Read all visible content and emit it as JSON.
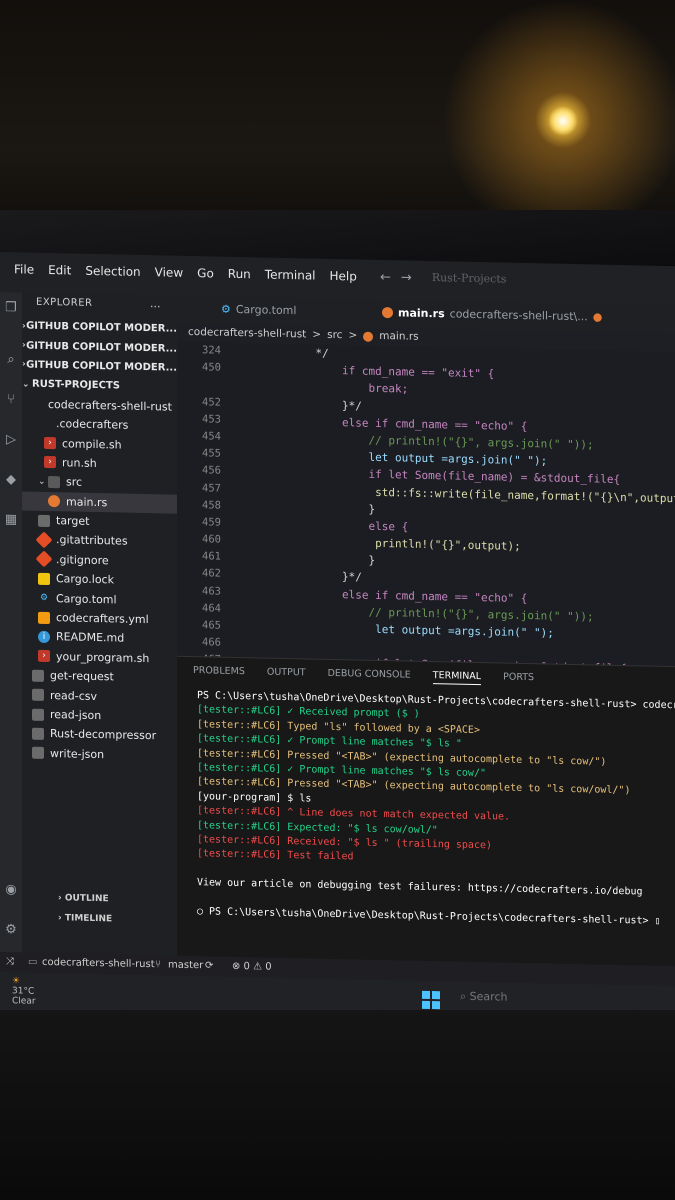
{
  "menu": [
    "File",
    "Edit",
    "Selection",
    "View",
    "Go",
    "Run",
    "Terminal",
    "Help"
  ],
  "nav": {
    "back": "←",
    "forward": "→",
    "search": "Rust-Projects"
  },
  "explorer": {
    "title": "EXPLORER",
    "dots": "...",
    "items": [
      {
        "label": "GITHUB COPILOT MODER...",
        "bold": true,
        "chev": ">"
      },
      {
        "label": "GITHUB COPILOT MODER...",
        "bold": true,
        "chev": ">"
      },
      {
        "label": "GITHUB COPILOT MODER...",
        "bold": true,
        "chev": ">"
      },
      {
        "label": "RUST-PROJECTS",
        "bold": true,
        "chev": "v"
      },
      {
        "label": "codecrafters-shell-rust"
      },
      {
        "label": ".codecrafters"
      },
      {
        "label": "compile.sh"
      },
      {
        "label": "run.sh"
      },
      {
        "label": "src"
      },
      {
        "label": "main.rs"
      },
      {
        "label": "target"
      },
      {
        "label": ".gitattributes"
      },
      {
        "label": ".gitignore"
      },
      {
        "label": "Cargo.lock"
      },
      {
        "label": "Cargo.toml"
      },
      {
        "label": "codecrafters.yml"
      },
      {
        "label": "README.md"
      },
      {
        "label": "your_program.sh"
      },
      {
        "label": "get-request"
      },
      {
        "label": "read-csv"
      },
      {
        "label": "read-json"
      },
      {
        "label": "Rust-decompressor"
      },
      {
        "label": "write-json"
      }
    ],
    "outline": "OUTLINE",
    "timeline": "TIMELINE"
  },
  "tabs": [
    {
      "label": "Cargo.toml"
    },
    {
      "label": "main.rs",
      "extra": "codecrafters-shell-rust\\..."
    }
  ],
  "breadcrumb": [
    "codecrafters-shell-rust",
    ">",
    "src",
    ">",
    "main.rs"
  ],
  "editor": {
    "lines": [
      {
        "n": "324",
        "t": "    */"
      },
      {
        "n": "450",
        "t": "        if cmd_name == \"exit\" {"
      },
      {
        "n": "",
        "t": "            break;"
      },
      {
        "n": "452",
        "t": "        }*/"
      },
      {
        "n": "453",
        "t": "        else if cmd_name == \"echo\" {"
      },
      {
        "n": "454",
        "t": "            // println!(\"{}\", args.join(\" \"));"
      },
      {
        "n": "455",
        "t": "            let output =args.join(\" \");"
      },
      {
        "n": "456",
        "t": "            if let Some(file_name) = &stdout_file{"
      },
      {
        "n": "457",
        "t": "             std::fs::write(file_name,format!(\"{}\\n\",output)).unwrap();"
      },
      {
        "n": "458",
        "t": "            }"
      },
      {
        "n": "459",
        "t": "            else {"
      },
      {
        "n": "460",
        "t": "             println!(\"{}\",output);"
      },
      {
        "n": "461",
        "t": "            }"
      },
      {
        "n": "462",
        "t": "        }*/"
      },
      {
        "n": "463",
        "t": "        else if cmd_name == \"echo\" {"
      },
      {
        "n": "464",
        "t": "            // println!(\"{}\", args.join(\" \"));"
      },
      {
        "n": "465",
        "t": "             let output =args.join(\" \");"
      },
      {
        "n": "466",
        "t": ""
      },
      {
        "n": "467",
        "t": "             if let Some(file_name) = &stdout_file{"
      }
    ]
  },
  "panel": {
    "tabs": [
      "PROBLEMS",
      "OUTPUT",
      "DEBUG CONSOLE",
      "TERMINAL",
      "PORTS"
    ],
    "active": "TERMINAL",
    "terminal": [
      {
        "t": "PS C:\\Users\\tusha\\OneDrive\\Desktop\\Rust-Projects\\codecrafters-shell-rust> codecraf",
        "c": "w"
      },
      {
        "t": "[tester::#LC6] ✓ Received prompt ($ )",
        "c": "g"
      },
      {
        "t": "[tester::#LC6] Typed \"ls\" followed by a <SPACE>",
        "c": "y"
      },
      {
        "t": "[tester::#LC6] ✓ Prompt line matches \"$ ls \"",
        "c": "g"
      },
      {
        "t": "[tester::#LC6] Pressed \"<TAB>\" (expecting autocomplete to \"ls cow/\")",
        "c": "y"
      },
      {
        "t": "[tester::#LC6] ✓ Prompt line matches \"$ ls cow/\"",
        "c": "g"
      },
      {
        "t": "[tester::#LC6] Pressed \"<TAB>\" (expecting autocomplete to \"ls cow/owl/\")",
        "c": "y"
      },
      {
        "t": "[your-program] $ ls",
        "c": "w"
      },
      {
        "t": "[tester::#LC6] ^ Line does not match expected value.",
        "c": "r"
      },
      {
        "t": "[tester::#LC6] Expected: \"$ ls cow/owl/\"",
        "c": "g"
      },
      {
        "t": "[tester::#LC6] Received: \"$ ls \" (trailing space)",
        "c": "r"
      },
      {
        "t": "[tester::#LC6] Test failed",
        "c": "r"
      },
      {
        "t": "",
        "c": "w"
      },
      {
        "t": "View our article on debugging test failures: https://codecrafters.io/debug",
        "c": "w"
      },
      {
        "t": "",
        "c": "w"
      },
      {
        "t": "○ PS C:\\Users\\tusha\\OneDrive\\Desktop\\Rust-Projects\\codecrafters-shell-rust> ▯",
        "c": "w"
      }
    ]
  },
  "status": {
    "project": "codecrafters-shell-rust",
    "branch": "master",
    "problems": "⊗ 0 ⚠ 0"
  },
  "taskbar": {
    "temp": "31°C",
    "weather": "Clear",
    "search": "Search"
  }
}
